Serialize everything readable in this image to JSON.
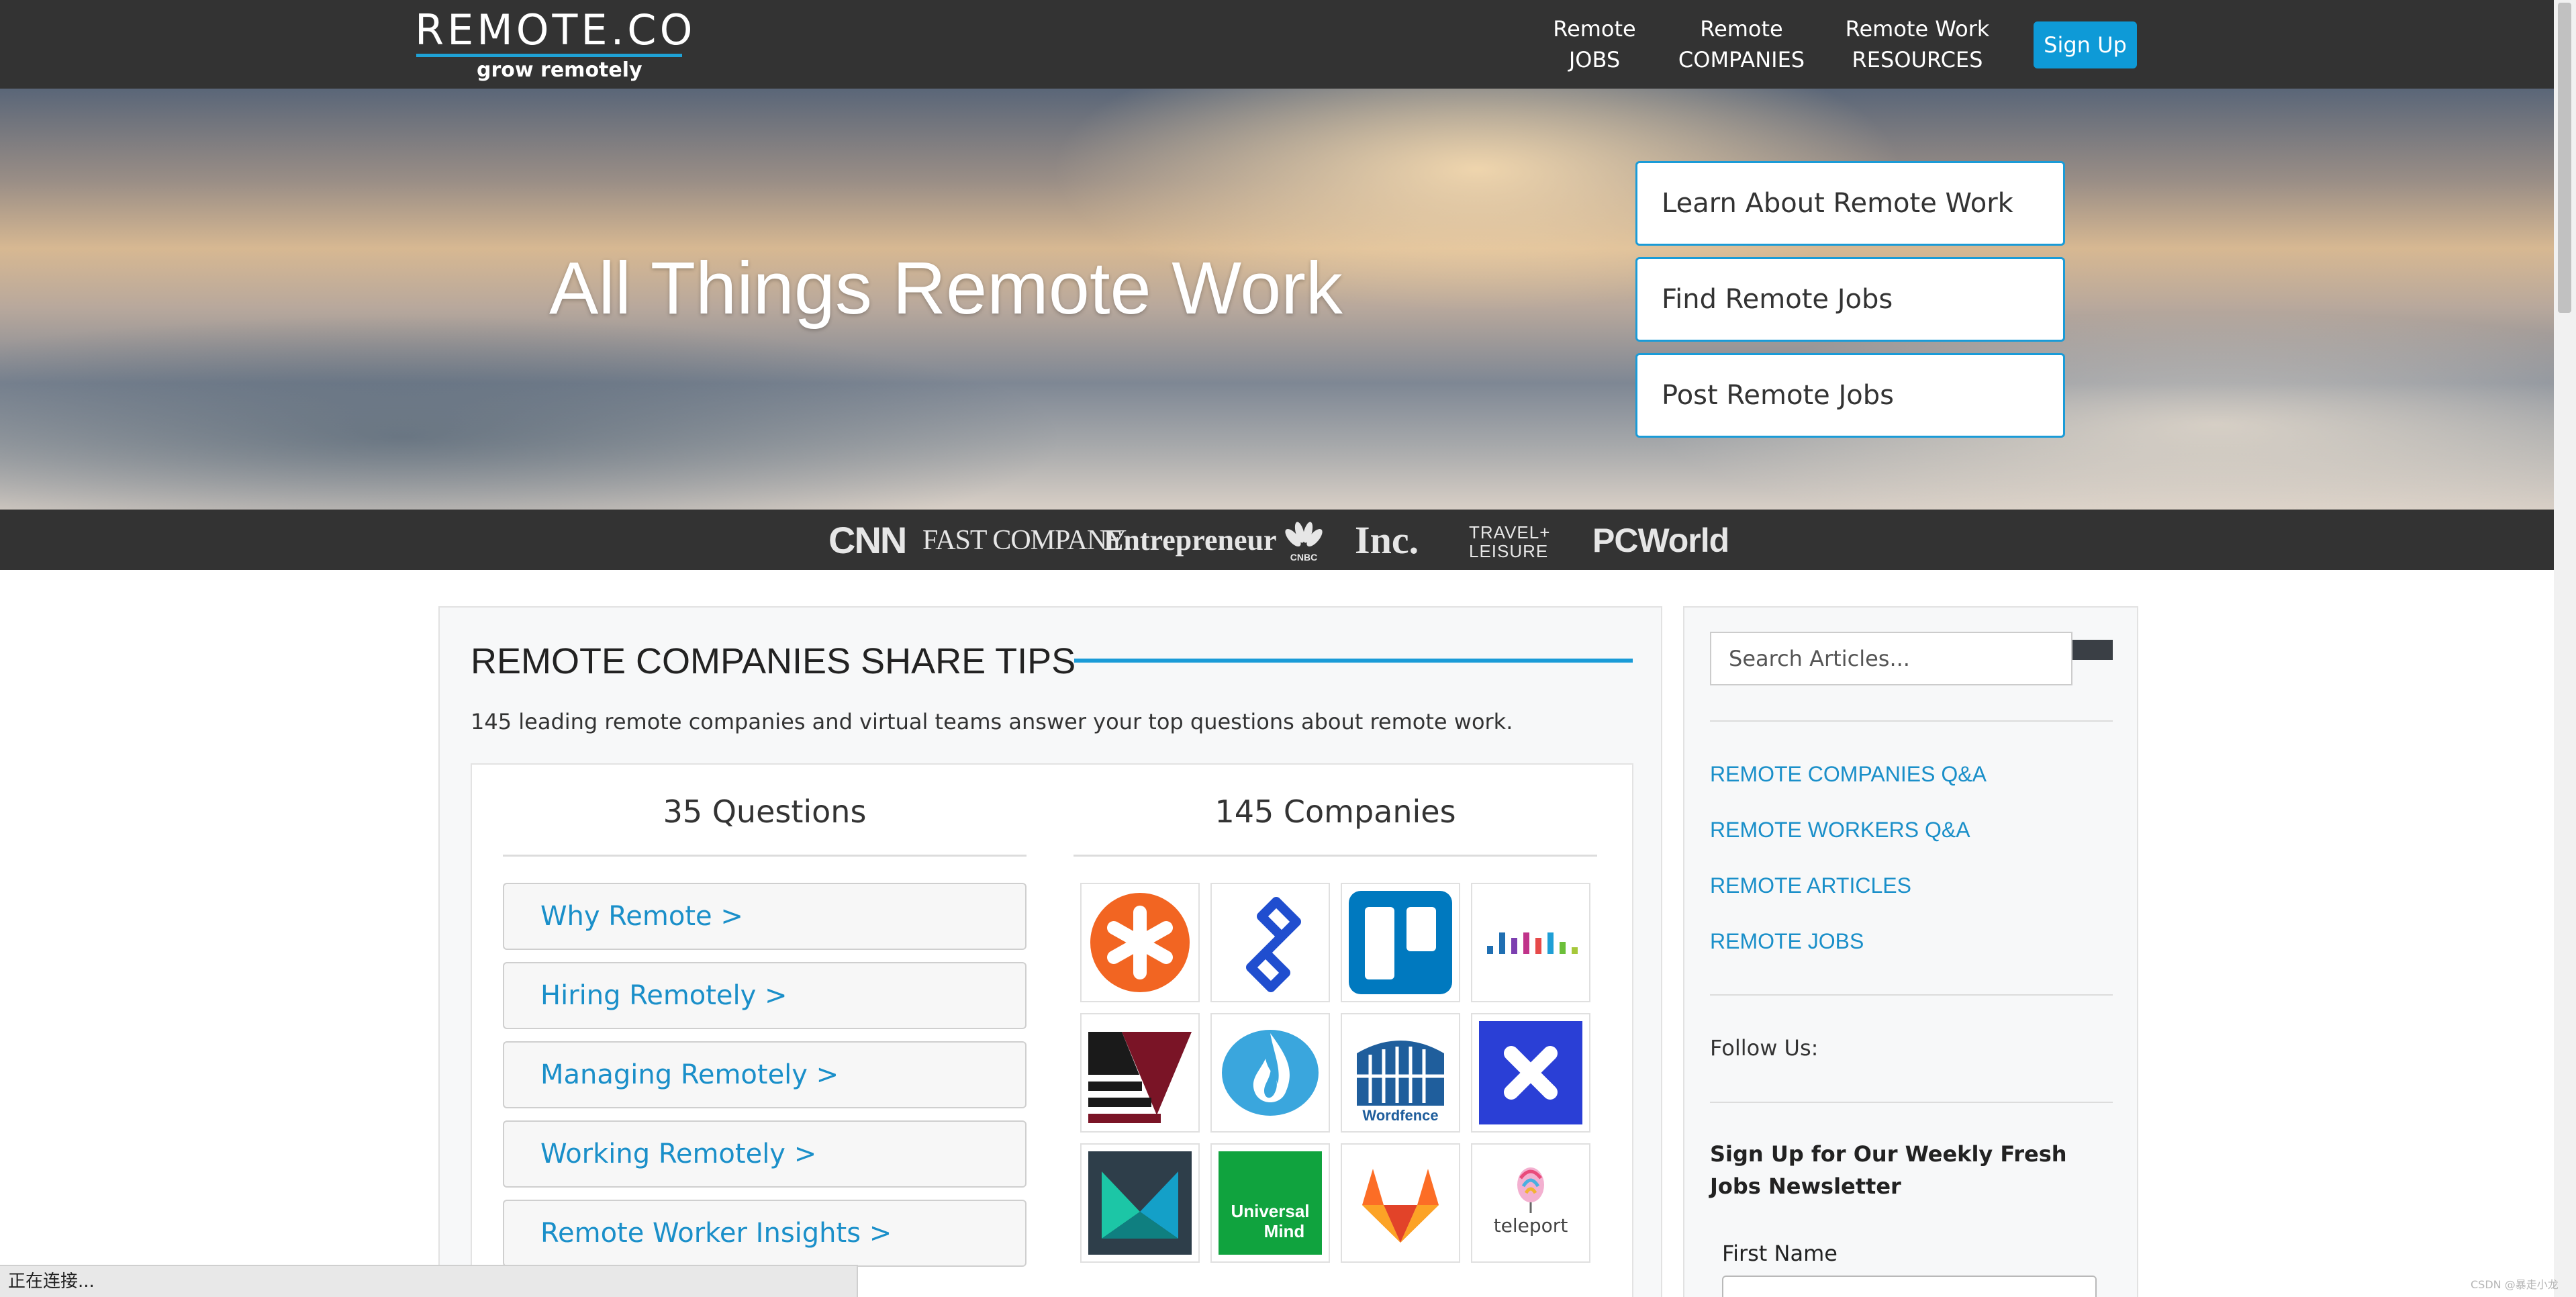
{
  "header": {
    "logo_text": "REMOTE.CO",
    "logo_tagline": "grow remotely",
    "nav": [
      {
        "line1": "Remote",
        "line2": "JOBS"
      },
      {
        "line1": "Remote",
        "line2": "COMPANIES"
      },
      {
        "line1": "Remote Work",
        "line2": "RESOURCES"
      }
    ],
    "signup_label": "Sign Up"
  },
  "hero": {
    "title": "All Things Remote Work",
    "buttons": [
      "Learn About Remote Work",
      "Find Remote Jobs",
      "Post Remote Jobs"
    ]
  },
  "press": {
    "cnn": "CNN",
    "fast_company": "FAST COMPANY",
    "entrepreneur": "Entrepreneur",
    "cnbc": "CNBC",
    "inc": "Inc.",
    "travel_line1": "TRAVEL+",
    "travel_line2": "LEISURE",
    "pcworld": "PCWorld"
  },
  "main": {
    "title": "REMOTE COMPANIES SHARE TIPS",
    "subtitle": "145 leading remote companies and virtual teams answer your top questions about remote work.",
    "questions_title": "35 Questions",
    "companies_title": "145 Companies",
    "questions": [
      "Why Remote >",
      "Hiring Remotely >",
      "Managing Remotely >",
      "Working Remotely >",
      "Remote Worker Insights >"
    ],
    "logos": [
      {
        "icon": "asterisk-logo-icon",
        "color": "#f26522"
      },
      {
        "icon": "toptal-logo-icon",
        "color": "#204ecf"
      },
      {
        "icon": "trello-logo-icon",
        "color": "#0079bf"
      },
      {
        "icon": "bars-logo-icon",
        "color": "#1f6fb2"
      },
      {
        "icon": "triangle-logo-icon",
        "color": "#7a1426"
      },
      {
        "icon": "flame-logo-icon",
        "color": "#2b8fd8"
      },
      {
        "icon": "wordfence-logo-icon",
        "color": "#1f5e9c",
        "text": "Wordfence"
      },
      {
        "icon": "x-logo-icon",
        "color": "#2a3fd6"
      },
      {
        "icon": "m-logo-icon",
        "color": "#2e3e4a"
      },
      {
        "icon": "universal-mind-logo-icon",
        "color": "#10a33e",
        "text_line1": "Universal",
        "text_line2": "Mind"
      },
      {
        "icon": "gitlab-logo-icon",
        "color": "#e24329"
      },
      {
        "icon": "teleport-logo-icon",
        "color": "#444444",
        "text": "teleport"
      }
    ]
  },
  "sidebar": {
    "search_placeholder": "Search Articles...",
    "links": [
      "REMOTE COMPANIES Q&A",
      "REMOTE WORKERS Q&A",
      "REMOTE ARTICLES",
      "REMOTE JOBS"
    ],
    "follow_label": "Follow Us:",
    "newsletter_title": "Sign Up for Our Weekly Fresh Jobs Newsletter",
    "first_name_label": "First Name"
  },
  "status": {
    "text": "正在连接...",
    "watermark": "CSDN @暴走小龙"
  },
  "colors": {
    "accent": "#1a9bd7",
    "dark": "#333333",
    "link": "#1a8fc9"
  }
}
